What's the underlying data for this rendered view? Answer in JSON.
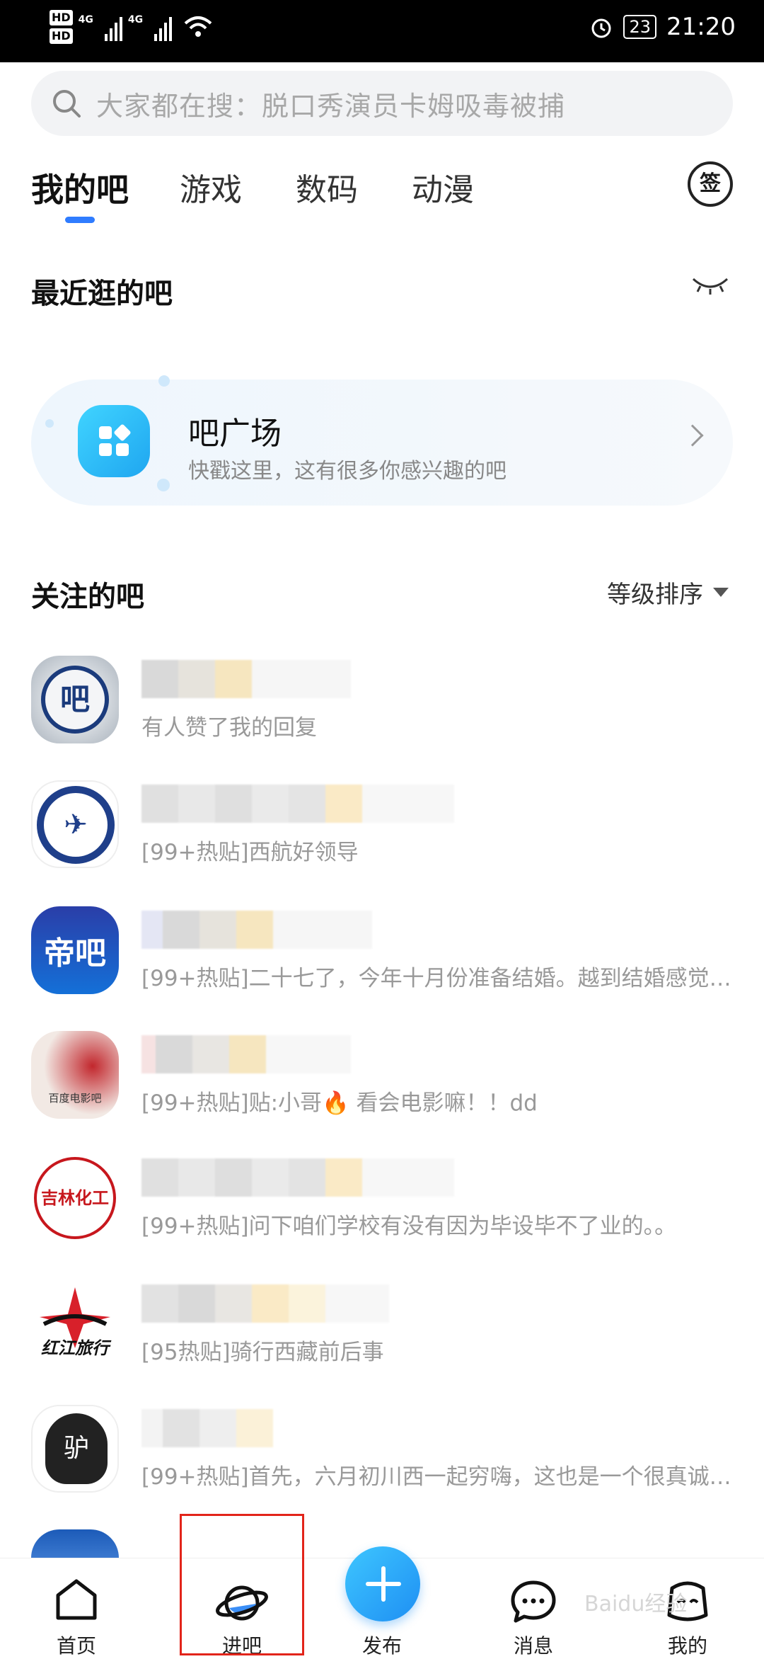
{
  "status_bar": {
    "hd1": "HD",
    "hd2": "HD",
    "net1": "4G",
    "net2": "4G",
    "battery": "23",
    "time": "21:20"
  },
  "search": {
    "placeholder": "大家都在搜：脱口秀演员卡姆吸毒被捕"
  },
  "tabs": [
    {
      "label": "我的吧",
      "active": true
    },
    {
      "label": "游戏"
    },
    {
      "label": "数码"
    },
    {
      "label": "动漫"
    }
  ],
  "sign_button": "签",
  "recent": {
    "title": "最近逛的吧"
  },
  "plaza": {
    "title": "吧广场",
    "subtitle": "快戳这里，这有很多你感兴趣的吧"
  },
  "followed": {
    "title": "关注的吧",
    "sort_label": "等级排序"
  },
  "bars": [
    {
      "snippet": "有人赞了我的回复",
      "avatar_text": "吧"
    },
    {
      "snippet": "[99+热贴]西航好领导",
      "avatar_text": "✈"
    },
    {
      "snippet": "[99+热贴]二十七了，今年十月份准备结婚。越到结婚感觉…",
      "avatar_text": "帝吧"
    },
    {
      "snippet": "[99+热贴]贴:小哥🔥 看会电影嘛！！dd",
      "avatar_text": "百度电影吧"
    },
    {
      "snippet": "[99+热贴]问下咱们学校有没有因为毕设毕不了业的。。",
      "avatar_text": "吉林化工"
    },
    {
      "snippet": "[95热贴]骑行西藏前后事",
      "avatar_text": "红江旅行"
    },
    {
      "snippet": "[99+热贴]首先，六月初川西一起穷嗨，这也是一个很真诚…",
      "avatar_text": "驴"
    }
  ],
  "bottom_nav": {
    "home": "首页",
    "enter_bar": "进吧",
    "publish": "发布",
    "messages": "消息",
    "mine": "我的"
  },
  "watermark": "Baidu经验",
  "colors": {
    "accent": "#2f7cff",
    "highlight": "#e2241a"
  }
}
